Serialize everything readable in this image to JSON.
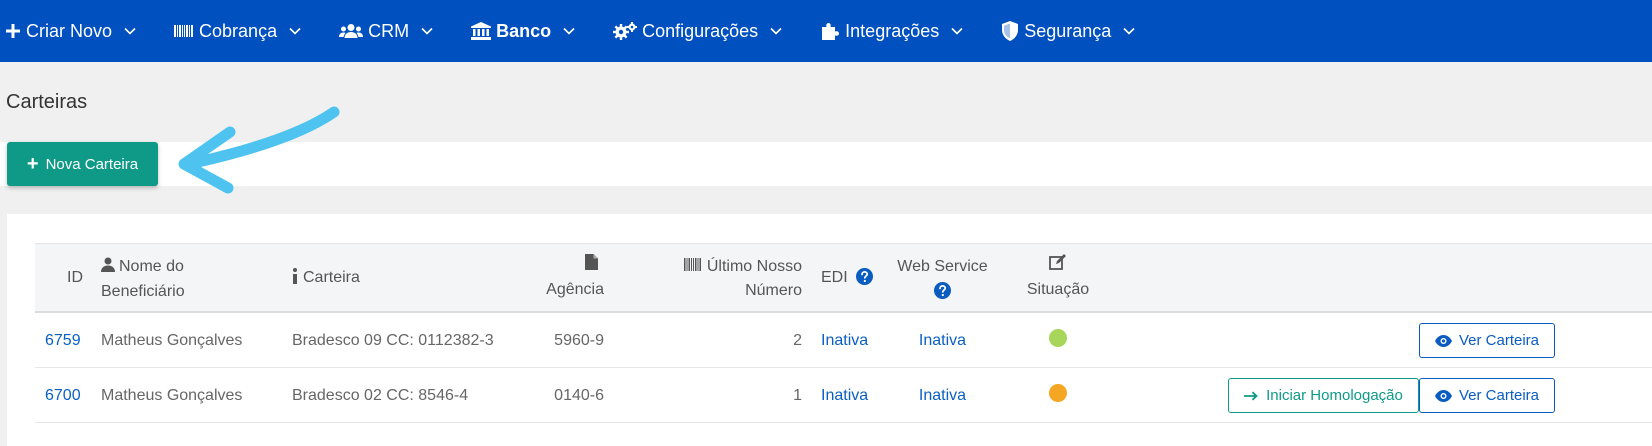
{
  "nav": {
    "items": [
      {
        "label": "Criar Novo",
        "icon": "plus-icon"
      },
      {
        "label": "Cobrança",
        "icon": "barcode-icon"
      },
      {
        "label": "CRM",
        "icon": "users-icon"
      },
      {
        "label": "Banco",
        "icon": "bank-icon"
      },
      {
        "label": "Configurações",
        "icon": "gears-icon"
      },
      {
        "label": "Integrações",
        "icon": "puzzle-icon"
      },
      {
        "label": "Segurança",
        "icon": "shield-icon"
      }
    ]
  },
  "page": {
    "title": "Carteiras",
    "new_button": "Nova Carteira"
  },
  "table": {
    "headers": {
      "id": "ID",
      "nome": "Nome do Beneficiário",
      "carteira": "Carteira",
      "agencia": "Agência",
      "ultimo": "Último Nosso Número",
      "edi": "EDI",
      "ws": "Web Service",
      "situacao": "Situação"
    },
    "rows": [
      {
        "id": "6759",
        "nome": "Matheus Gonçalves",
        "carteira": "Bradesco 09 CC: 0112382-3",
        "agencia": "5960-9",
        "ultimo": "2",
        "edi": "Inativa",
        "ws": "Inativa",
        "status_color": "#a8d65a",
        "ver": "Ver Carteira"
      },
      {
        "id": "6700",
        "nome": "Matheus Gonçalves",
        "carteira": "Bradesco 02 CC: 8546-4",
        "agencia": "0140-6",
        "ultimo": "1",
        "edi": "Inativa",
        "ws": "Inativa",
        "status_color": "#f5a623",
        "homolog": "Iniciar Homologação",
        "ver": "Ver Carteira"
      }
    ]
  },
  "colors": {
    "nav_bg": "#0050c0",
    "primary_green": "#0e9a87",
    "link_blue": "#0a60c2",
    "annotation_arrow": "#4fc3f0"
  }
}
